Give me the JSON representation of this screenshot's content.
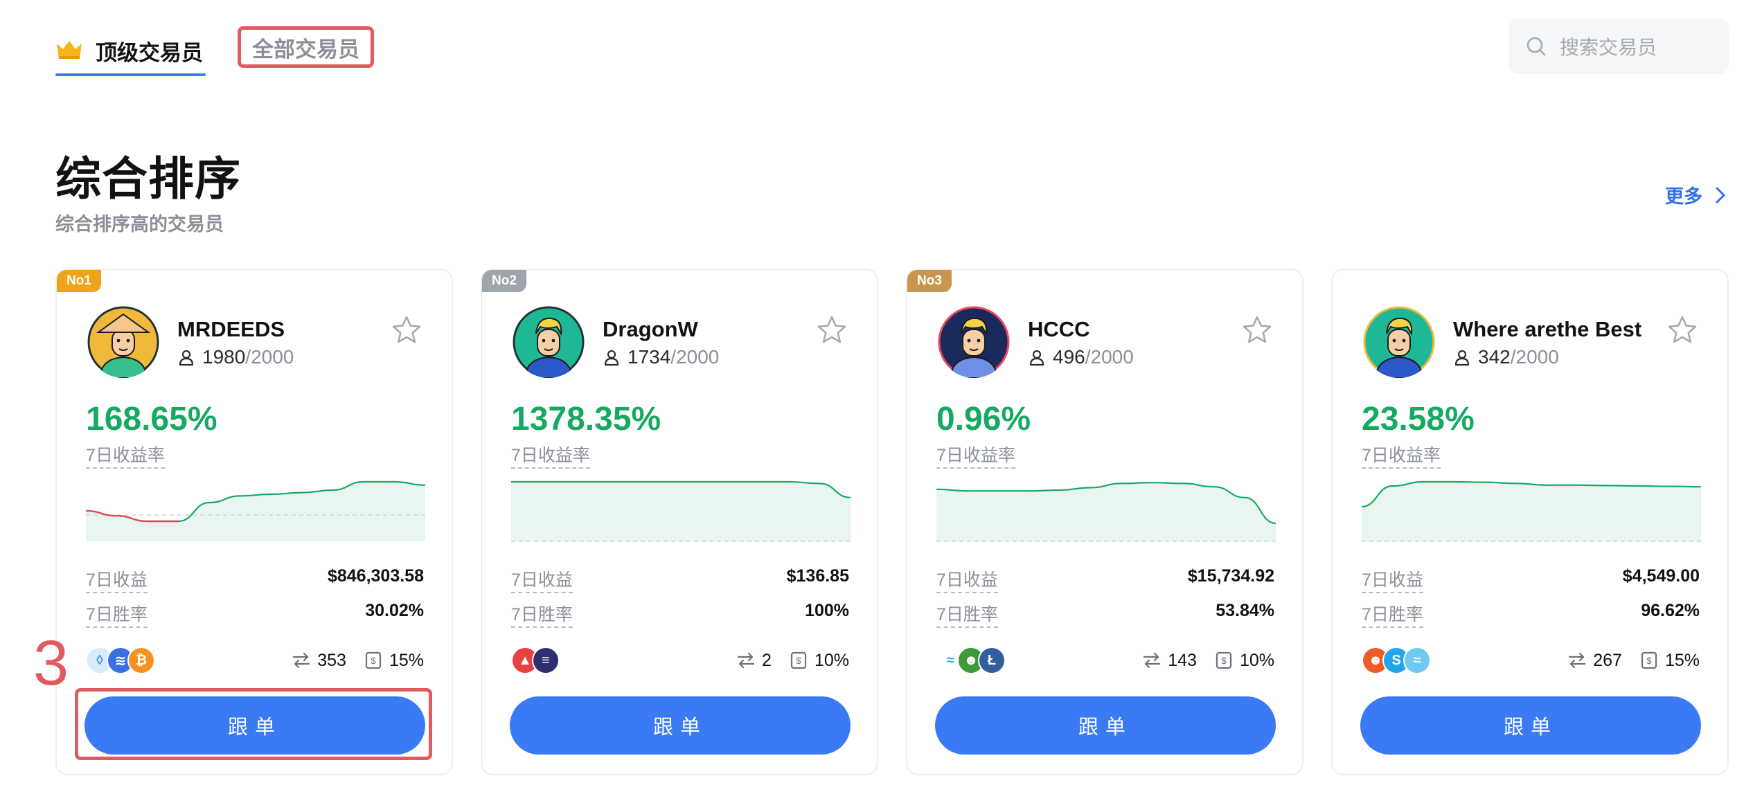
{
  "nav": {
    "tab_top": "顶级交易员",
    "tab_all": "全部交易员",
    "search_placeholder": "搜索交易员"
  },
  "section": {
    "title": "综合排序",
    "subtitle": "综合排序高的交易员",
    "more": "更多"
  },
  "labels": {
    "roi_label": "7日收益率",
    "pnl_label": "7日收益",
    "winrate_label": "7日胜率",
    "follow_button": "跟单"
  },
  "colors": {
    "accent": "#3a7bf5",
    "profit": "#17a862",
    "loss": "#e8465b",
    "badge_no1": "#efa31b",
    "badge_no2": "#a0a4ab",
    "badge_no3": "#c8964f"
  },
  "annotation": {
    "number": "3"
  },
  "traders": [
    {
      "rank": "No1",
      "name": "MRDEEDS",
      "followers": "1980",
      "followers_max": "/2000",
      "roi": "168.65%",
      "pnl": "$846,303.58",
      "winrate": "30.02%",
      "trades": "353",
      "profit_share": "15%",
      "coins": [
        "drop-coin-icon",
        "storage-coin-icon",
        "btc-icon"
      ],
      "trend": [
        0.3,
        0.18,
        0.05,
        0.05,
        0.5,
        0.66,
        0.7,
        0.74,
        0.8,
        1.0,
        1.0,
        0.92
      ]
    },
    {
      "rank": "No2",
      "name": "DragonW",
      "followers": "1734",
      "followers_max": "/2000",
      "roi": "1378.35%",
      "pnl": "$136.85",
      "winrate": "100%",
      "trades": "2",
      "profit_share": "10%",
      "coins": [
        "avax-icon",
        "sol-icon"
      ],
      "trend": [
        1.0,
        1.0,
        1.0,
        1.0,
        1.0,
        1.0,
        1.0,
        1.0,
        1.0,
        1.0,
        0.96,
        0.62
      ]
    },
    {
      "rank": "No3",
      "name": "HCCC",
      "followers": "496",
      "followers_max": "/2000",
      "roi": "0.96%",
      "pnl": "$15,734.92",
      "winrate": "53.84%",
      "trades": "143",
      "profit_share": "10%",
      "coins": [
        "nervos-icon",
        "pepe-icon",
        "ltc-icon"
      ],
      "trend": [
        0.82,
        0.78,
        0.78,
        0.78,
        0.8,
        0.86,
        0.96,
        0.98,
        0.96,
        0.88,
        0.62,
        0.0
      ]
    },
    {
      "rank": "",
      "name": "Where arethe Best",
      "followers": "342",
      "followers_max": "/2000",
      "roi": "23.58%",
      "pnl": "$4,549.00",
      "winrate": "96.62%",
      "trades": "267",
      "profit_share": "15%",
      "coins": [
        "shib-icon",
        "sandbox-icon",
        "sui-icon"
      ],
      "trend": [
        0.4,
        0.9,
        1.0,
        1.0,
        0.99,
        0.96,
        0.92,
        0.92,
        0.91,
        0.9,
        0.89,
        0.88
      ]
    }
  ]
}
